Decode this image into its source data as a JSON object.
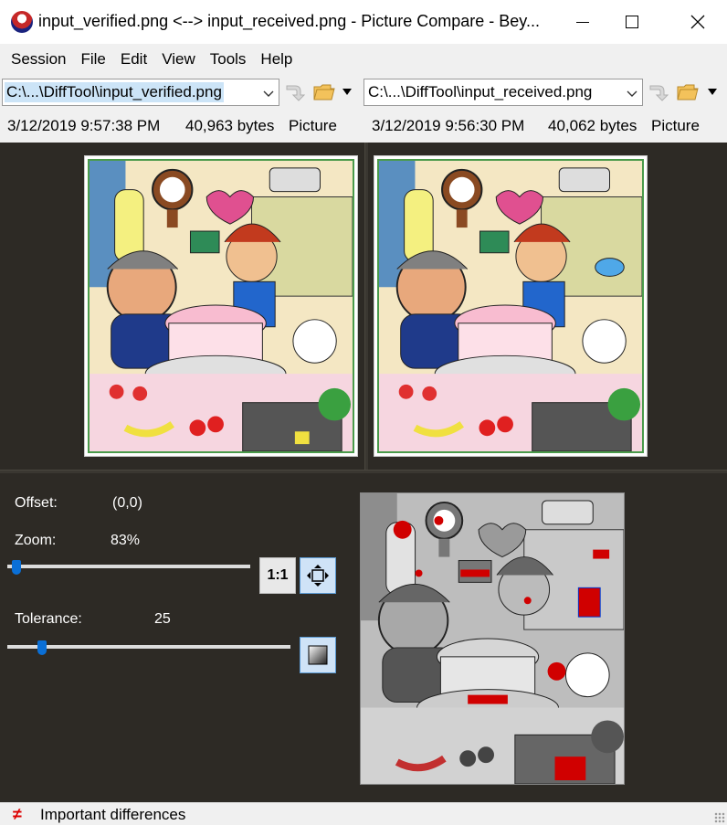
{
  "window": {
    "title": "input_verified.png <--> input_received.png - Picture Compare - Bey..."
  },
  "menu": [
    "Session",
    "File",
    "Edit",
    "View",
    "Tools",
    "Help"
  ],
  "left": {
    "path": "C:\\...\\DiffTool\\input_verified.png",
    "date": "3/12/2019 9:57:38 PM",
    "size": "40,963 bytes",
    "format": "Picture"
  },
  "right": {
    "path": "C:\\...\\DiffTool\\input_received.png",
    "date": "3/12/2019 9:56:30 PM",
    "size": "40,062 bytes",
    "format": "Picture"
  },
  "controls": {
    "offset_label": "Offset:",
    "offset_value": "(0,0)",
    "zoom_label": "Zoom:",
    "zoom_value": "83%",
    "tolerance_label": "Tolerance:",
    "tolerance_value": "25",
    "one_to_one_label": "1:1",
    "zoom_slider_fraction": 0.02,
    "tolerance_slider_fraction": 0.11
  },
  "status": {
    "text": "Important differences",
    "icon": "not-equal-icon"
  },
  "colors": {
    "panel_bg": "#2d2a25",
    "chrome_bg": "#f0f0f0",
    "selection": "#cce4f7",
    "accent": "#0a6fd6",
    "diff_red": "#d00000",
    "frame_green": "#4a9a4a"
  }
}
